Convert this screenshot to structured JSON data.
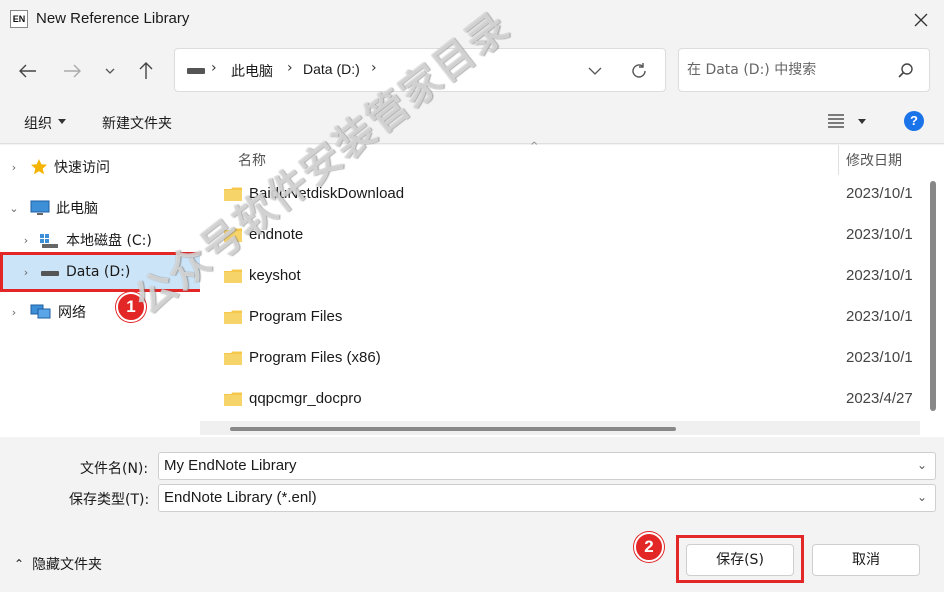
{
  "window": {
    "app_badge": "EN",
    "title": "New Reference Library"
  },
  "address": {
    "crumbs": [
      "此电脑",
      "Data (D:)"
    ]
  },
  "search": {
    "placeholder": "在 Data (D:) 中搜索"
  },
  "toolbar": {
    "organize": "组织",
    "new_folder": "新建文件夹",
    "help": "?"
  },
  "sidebar": {
    "items": [
      {
        "label": "快速访问",
        "icon": "star-icon"
      },
      {
        "label": "此电脑",
        "icon": "pc-icon"
      },
      {
        "label": "本地磁盘 (C:)",
        "icon": "drive-c-icon"
      },
      {
        "label": "Data (D:)",
        "icon": "drive-icon"
      },
      {
        "label": "网络",
        "icon": "network-icon"
      }
    ]
  },
  "columns": {
    "name": "名称",
    "date": "修改日期"
  },
  "files": [
    {
      "name": "BaiduNetdiskDownload",
      "date": "2023/10/1"
    },
    {
      "name": "endnote",
      "date": "2023/10/1"
    },
    {
      "name": "keyshot",
      "date": "2023/10/1"
    },
    {
      "name": "Program Files",
      "date": "2023/10/1"
    },
    {
      "name": "Program Files (x86)",
      "date": "2023/10/1"
    },
    {
      "name": "qqpcmgr_docpro",
      "date": "2023/4/27"
    }
  ],
  "form": {
    "filename_label": "文件名(N):",
    "filename_value": "My EndNote Library",
    "filetype_label": "保存类型(T):",
    "filetype_value": "EndNote Library (*.enl)"
  },
  "footer": {
    "hide_folders": "隐藏文件夹",
    "save": "保存(S)",
    "cancel": "取消"
  },
  "annotations": {
    "badge1": "1",
    "badge2": "2"
  },
  "watermark": "公众号软件安装管家目录",
  "colors": {
    "highlight": "#e32626",
    "selection": "#cce4f7",
    "folder": "#f5c84c",
    "accent": "#1a73e8"
  }
}
